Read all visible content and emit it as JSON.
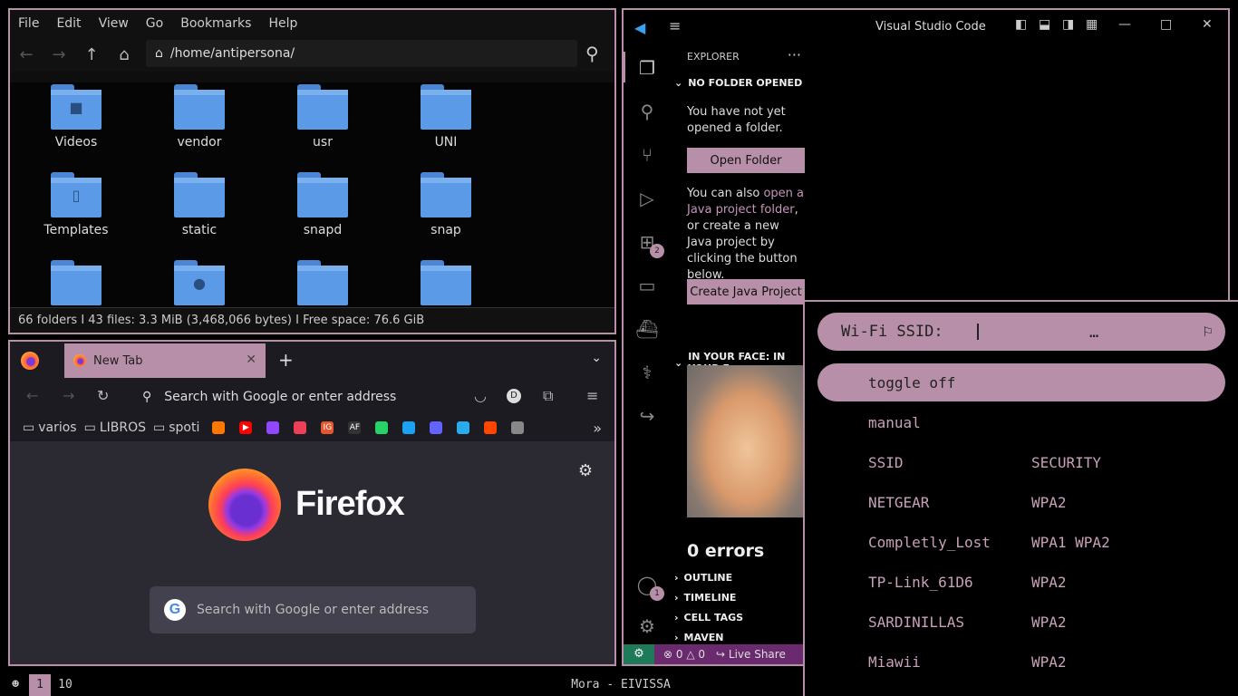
{
  "file_manager": {
    "menu": [
      "File",
      "Edit",
      "View",
      "Go",
      "Bookmarks",
      "Help"
    ],
    "path": "/home/antipersona/",
    "items": [
      {
        "name": "Videos",
        "glyph": "■"
      },
      {
        "name": "vendor",
        "glyph": ""
      },
      {
        "name": "usr",
        "glyph": ""
      },
      {
        "name": "UNI",
        "glyph": ""
      },
      {
        "name": "Templates",
        "glyph": "▯"
      },
      {
        "name": "static",
        "glyph": ""
      },
      {
        "name": "snapd",
        "glyph": ""
      },
      {
        "name": "snap",
        "glyph": ""
      },
      {
        "name": "",
        "glyph": ""
      },
      {
        "name": "",
        "glyph": "●"
      },
      {
        "name": "",
        "glyph": ""
      },
      {
        "name": "",
        "glyph": ""
      }
    ],
    "status": "66 folders  I  43 files: 3.3 MiB (3,468,066 bytes)  I  Free space: 76.6 GiB"
  },
  "firefox": {
    "tab_title": "New Tab",
    "url_placeholder": "Search with Google or enter address",
    "bookmarks": [
      "varios",
      "LIBROS",
      "spoti"
    ],
    "bookmark_icons": [
      {
        "label": "",
        "color": "#ff7700"
      },
      {
        "label": "▶",
        "color": "#ff0000"
      },
      {
        "label": "",
        "color": "#9146ff"
      },
      {
        "label": "",
        "color": "#ef3f56"
      },
      {
        "label": "IG",
        "color": "#e4572e"
      },
      {
        "label": "AF",
        "color": "#333333"
      },
      {
        "label": "",
        "color": "#25d366"
      },
      {
        "label": "",
        "color": "#1da1f2"
      },
      {
        "label": "",
        "color": "#6364ff"
      },
      {
        "label": "",
        "color": "#2aabee"
      },
      {
        "label": "",
        "color": "#ff4500"
      },
      {
        "label": "",
        "color": "#888888"
      }
    ],
    "wordmark": "Firefox",
    "search_placeholder": "Search with Google or enter address"
  },
  "vscode": {
    "title": "Visual Studio Code",
    "explorer_header": "EXPLORER",
    "no_folder": "NO FOLDER OPENED",
    "not_opened_text": "You have not yet opened a folder.",
    "open_folder": "Open Folder",
    "java_text_pre": "You can also ",
    "java_link": "open a Java project folder",
    "java_text_post": ", or create a new Java project by clicking the button below.",
    "create_java": "Create Java Project",
    "in_your_face": "IN YOUR FACE: IN YOUR F",
    "errors": "0 errors",
    "sections": [
      "OUTLINE",
      "TIMELINE",
      "CELL TAGS",
      "MAVEN"
    ],
    "extensions_badge": "2",
    "accounts_badge": "1",
    "status_errors": "0",
    "status_warnings": "0",
    "live_share": "Live Share"
  },
  "wifi": {
    "prompt": "Wi-Fi SSID:",
    "ellipsis": "…",
    "rows": [
      {
        "c1": "toggle off",
        "c2": ""
      },
      {
        "c1": "manual",
        "c2": ""
      },
      {
        "c1": "SSID",
        "c2": "SECURITY"
      },
      {
        "c1": "NETGEAR",
        "c2": "WPA2"
      },
      {
        "c1": "Completly_Lost",
        "c2": "WPA1 WPA2"
      },
      {
        "c1": "TP-Link_61D6",
        "c2": "WPA2"
      },
      {
        "c1": "SARDINILLAS",
        "c2": "WPA2"
      },
      {
        "c1": "Miawii",
        "c2": "WPA2"
      }
    ]
  },
  "bar": {
    "workspaces": [
      "1",
      "10"
    ],
    "now_playing": "Mora - EIVISSA",
    "accent": "#b88fa8"
  }
}
